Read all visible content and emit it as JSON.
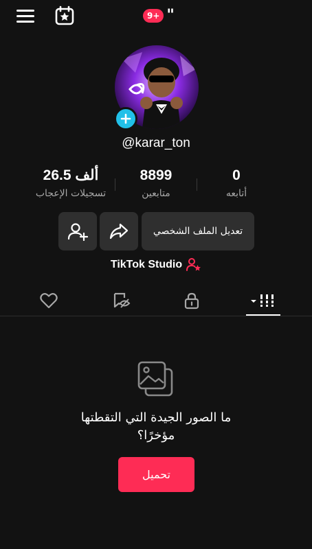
{
  "topbar": {
    "menu_icon": "hamburger-menu-icon",
    "calendar_icon": "calendar-star-icon",
    "notification_badge": "9+",
    "quote_mark": "\""
  },
  "profile": {
    "username": "@karar_ton",
    "avatar_icon": "cartoon-avatar-icon",
    "add_avatar_icon": "plus-icon"
  },
  "stats": {
    "following": {
      "value": "0",
      "label": "أتابعه"
    },
    "followers": {
      "value": "8899",
      "label": "متابعين"
    },
    "likes": {
      "value": "26.5 ألف",
      "label": "تسجيلات الإعجاب"
    }
  },
  "actions": {
    "edit_label": "تعديل الملف الشخصي",
    "share_icon": "share-arrow-icon",
    "add_friend_icon": "add-user-icon"
  },
  "studio": {
    "label": "TikTok Studio",
    "icon": "user-star-icon",
    "accent": "#fe2c55"
  },
  "tabs": [
    {
      "name": "videos",
      "icon": "grid-bars-icon",
      "active": true
    },
    {
      "name": "private",
      "icon": "lock-icon",
      "active": false
    },
    {
      "name": "reposts",
      "icon": "hidden-bookmark-icon",
      "active": false
    },
    {
      "name": "liked",
      "icon": "heart-icon",
      "active": false
    }
  ],
  "empty_state": {
    "icon": "photos-icon",
    "line1": "ما الصور الجيدة التي التقطتها",
    "line2": "مؤخرًا؟",
    "upload_label": "تحميل"
  },
  "colors": {
    "background": "#121212",
    "button": "#2f2f2f",
    "accent": "#fe2c55",
    "plus_badge": "#21c0e8",
    "muted_text": "#a8a8a8"
  }
}
